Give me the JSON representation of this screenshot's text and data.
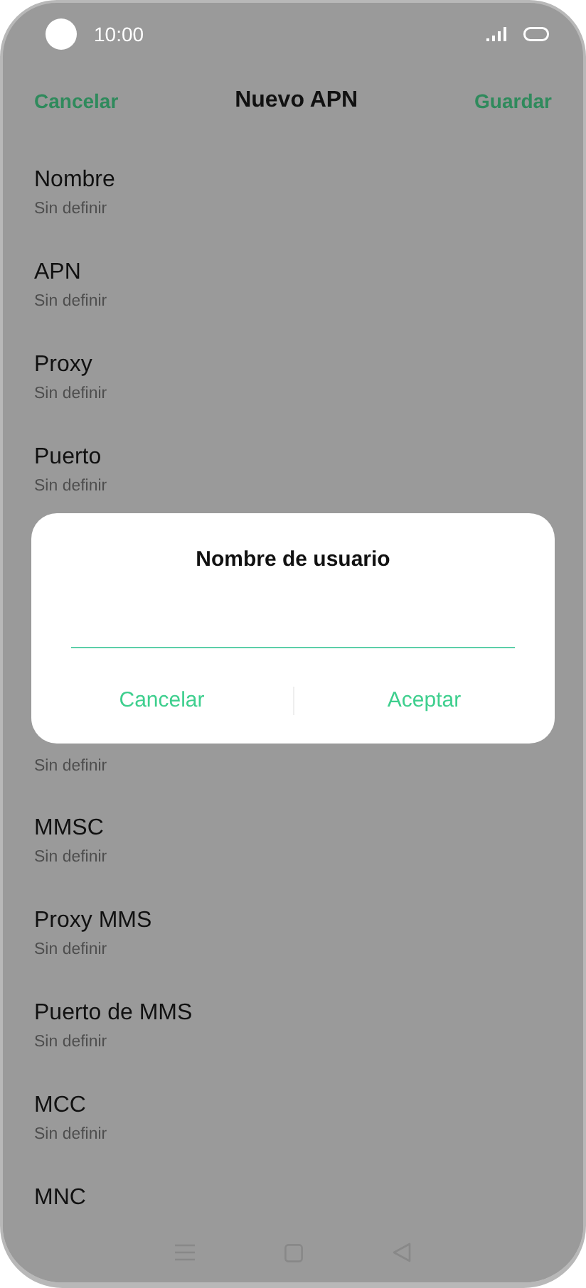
{
  "status_bar": {
    "time": "10:00"
  },
  "header": {
    "cancel": "Cancelar",
    "title": "Nuevo APN",
    "save": "Guardar"
  },
  "fields_top": [
    {
      "title": "Nombre",
      "value": "Sin definir"
    },
    {
      "title": "APN",
      "value": "Sin definir"
    },
    {
      "title": "Proxy",
      "value": "Sin definir"
    },
    {
      "title": "Puerto",
      "value": "Sin definir"
    }
  ],
  "dialog": {
    "title": "Nombre de usuario",
    "buttons": [
      "Cancelar",
      "Aceptar"
    ]
  },
  "fields_bottom": [
    {
      "value": "Sin definir"
    },
    {
      "title": "MMSC",
      "value": "Sin definir"
    },
    {
      "title": "Proxy MMS",
      "value": "Sin definir"
    },
    {
      "title": "Puerto de MMS",
      "value": "Sin definir"
    },
    {
      "title": "MCC",
      "value": "Sin definir"
    },
    {
      "title": "MNC"
    }
  ]
}
